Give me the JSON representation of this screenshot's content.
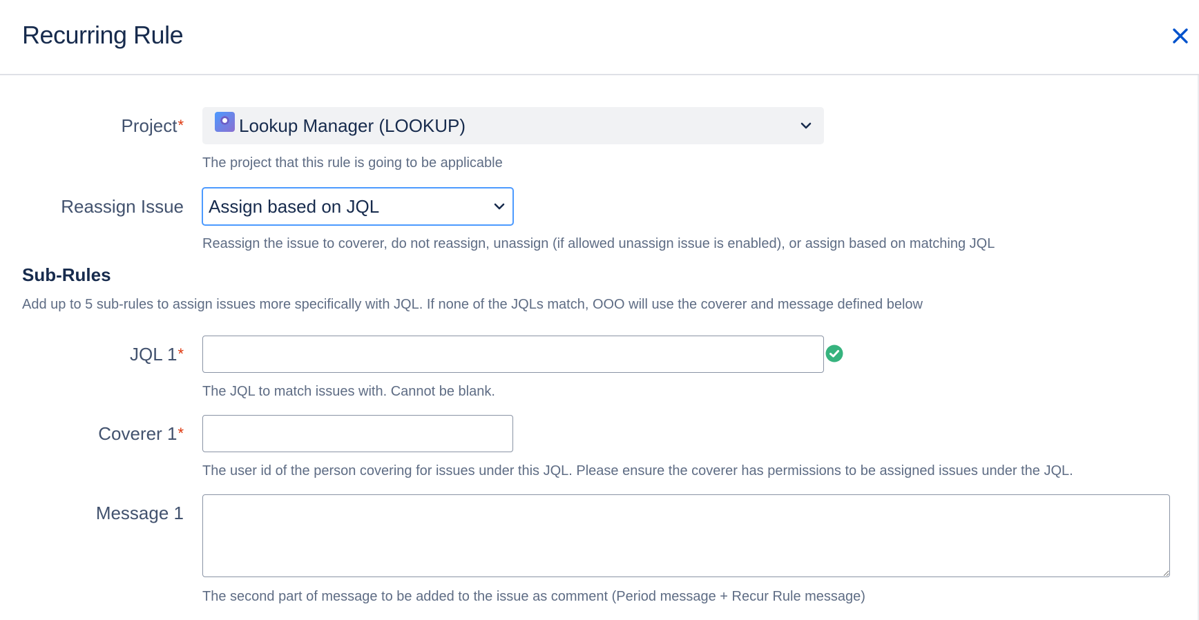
{
  "dialog": {
    "title": "Recurring Rule",
    "close_icon": "close-icon"
  },
  "project": {
    "label": "Project",
    "required_mark": "*",
    "value": "Lookup Manager (LOOKUP)",
    "icon": "project-avatar-icon",
    "help": "The project that this rule is going to be applicable"
  },
  "reassign": {
    "label": "Reassign Issue",
    "value": "Assign based on JQL",
    "help": "Reassign the issue to coverer, do not reassign, unassign (if allowed unassign issue is enabled), or assign based on matching JQL"
  },
  "subrules": {
    "title": "Sub-Rules",
    "description": "Add up to 5 sub-rules to assign issues more specifically with JQL. If none of the JQLs match, OOO will use the coverer and message defined below"
  },
  "jql1": {
    "label": "JQL 1",
    "required_mark": "*",
    "value": "",
    "status_icon": "check-circle-icon",
    "help": "The JQL to match issues with. Cannot be blank."
  },
  "coverer1": {
    "label": "Coverer 1",
    "required_mark": "*",
    "value": "",
    "help": "The user id of the person covering for issues under this JQL. Please ensure the coverer has permissions to be assigned issues under the JQL."
  },
  "message1": {
    "label": "Message 1",
    "value": "",
    "help": "The second part of message to be added to the issue as comment (Period message + Recur Rule message)"
  },
  "colors": {
    "accent": "#0052cc",
    "focus_border": "#4c9aff",
    "required": "#de350b",
    "success": "#36b37e",
    "help_text": "#5e6c84"
  }
}
